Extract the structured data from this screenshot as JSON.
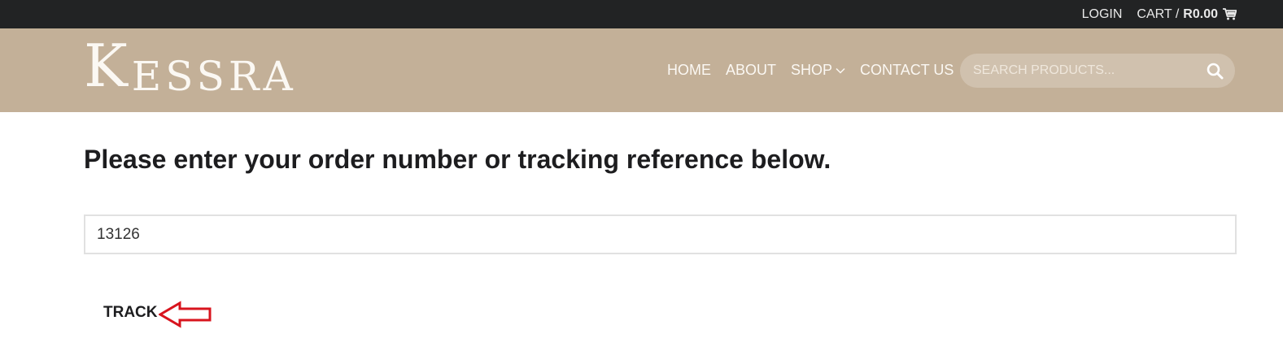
{
  "topbar": {
    "login": "LOGIN",
    "cart_label": "CART /",
    "cart_amount": "R0.00",
    "cart_icon": "cart-icon"
  },
  "header": {
    "logo_first": "K",
    "logo_rest": "ESSRA",
    "nav": [
      {
        "label": "HOME"
      },
      {
        "label": "ABOUT"
      },
      {
        "label": "SHOP",
        "icon": "chevron-down-icon"
      },
      {
        "label": "CONTACT US"
      }
    ],
    "search": {
      "placeholder": "SEARCH PRODUCTS...",
      "value": "",
      "icon": "search-icon"
    }
  },
  "main": {
    "heading": "Please enter your order number or tracking reference below.",
    "order_input_value": "13126",
    "track_label": "TRACK"
  },
  "colors": {
    "topbar_bg": "#222324",
    "header_bg": "#c3b098",
    "annotation_red": "#d8141e"
  }
}
